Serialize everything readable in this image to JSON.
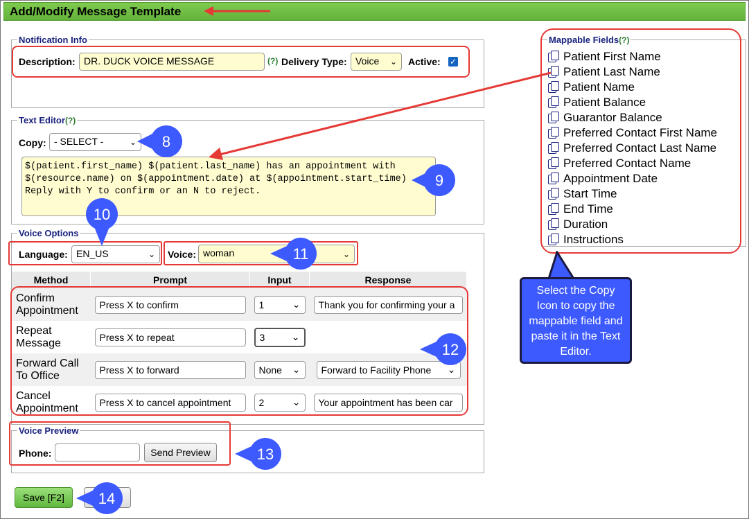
{
  "title": "Add/Modify Message Template",
  "notification": {
    "legend": "Notification Info",
    "description_label": "Description:",
    "description_value": "DR. DUCK VOICE MESSAGE",
    "help": "(?)",
    "delivery_label": "Delivery Type:",
    "delivery_value": "Voice",
    "active_label": "Active:"
  },
  "text_editor": {
    "legend": "Text Editor",
    "help": "(?)",
    "copy_label": "Copy:",
    "copy_value": "- SELECT -",
    "lines": [
      "$(patient.first_name) $(patient.last_name) has an appointment with",
      "$(resource.name) on $(appointment.date) at $(appointment.start_time)",
      "Reply with Y to confirm or an N to reject."
    ]
  },
  "voice_options": {
    "legend": "Voice Options",
    "language_label": "Language:",
    "language_value": "EN_US",
    "voice_label": "Voice:",
    "voice_value": "woman",
    "headers": [
      "Method",
      "Prompt",
      "Input",
      "Response"
    ],
    "rows": [
      {
        "method": "Confirm Appointment",
        "prompt": "Press X to confirm",
        "input": "1",
        "response": "Thank you for confirming your a"
      },
      {
        "method": "Repeat Message",
        "prompt": "Press X to repeat",
        "input": "3",
        "response": ""
      },
      {
        "method": "Forward Call To Office",
        "prompt": "Press X to forward",
        "input": "None",
        "response": "Forward to Facility Phone"
      },
      {
        "method": "Cancel Appointment",
        "prompt": "Press X to cancel appointment",
        "input": "2",
        "response": "Your appointment has been car"
      }
    ]
  },
  "voice_preview": {
    "legend": "Voice Preview",
    "phone_label": "Phone:",
    "phone_value": "",
    "send_label": "Send Preview"
  },
  "save_label": "Save [F2]",
  "mappable": {
    "legend": "Mappable Fields",
    "help": "(?)",
    "items": [
      "Patient First Name",
      "Patient Last Name",
      "Patient Name",
      "Patient Balance",
      "Guarantor Balance",
      "Preferred Contact First Name",
      "Preferred Contact Last Name",
      "Preferred Contact Name",
      "Appointment Date",
      "Start Time",
      "End Time",
      "Duration",
      "Instructions"
    ]
  },
  "callout_text": "Select the Copy Icon to copy the mappable field and paste it in the Text Editor.",
  "badges": [
    "8",
    "9",
    "10",
    "11",
    "12",
    "13",
    "14"
  ],
  "colors": {
    "accent_green": "#63b23a",
    "badge_blue": "#3d5afe",
    "highlight_red": "#e53935",
    "legend_navy": "#1a237e"
  }
}
